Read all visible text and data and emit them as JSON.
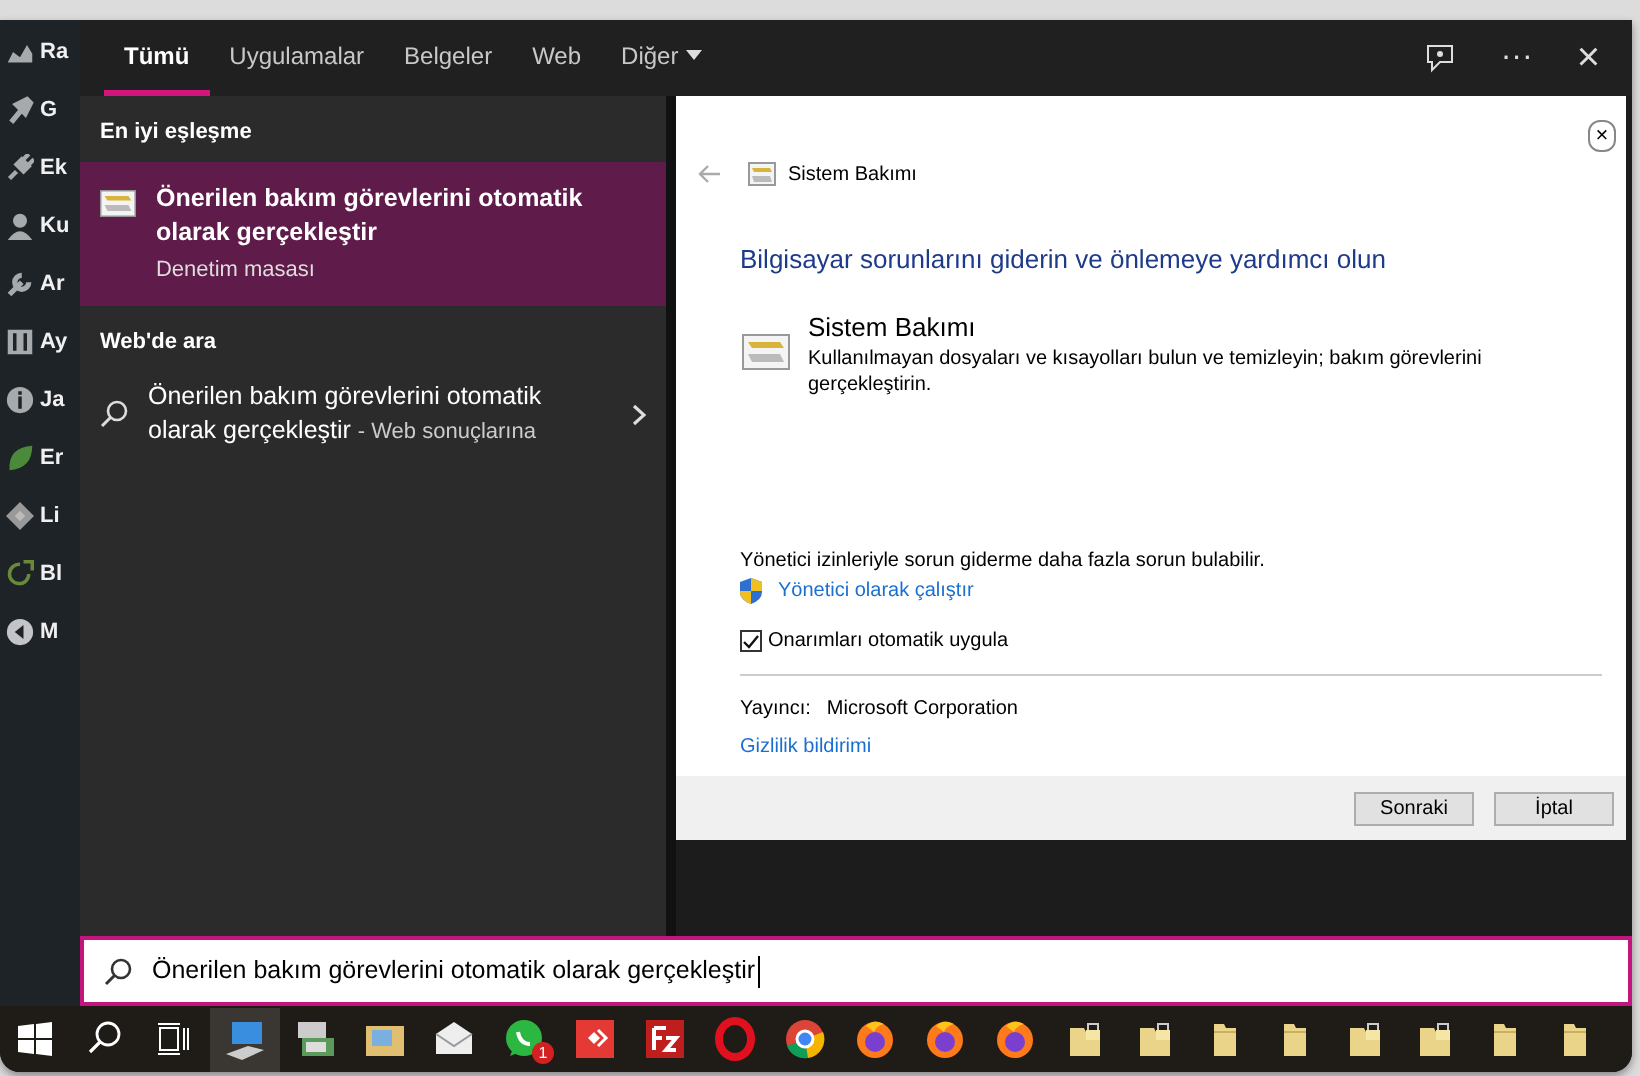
{
  "sidebar": {
    "items": [
      {
        "label": "Ra"
      },
      {
        "label": "G"
      },
      {
        "label": "Ek"
      },
      {
        "label": "Ku"
      },
      {
        "label": "Ar"
      },
      {
        "label": "Ay"
      },
      {
        "label": "Ja"
      },
      {
        "label": "Er"
      },
      {
        "label": "Li"
      },
      {
        "label": "Bl"
      },
      {
        "label": "M"
      }
    ]
  },
  "tabs": [
    {
      "label": "Tümü",
      "selected": true,
      "kind": "tab"
    },
    {
      "label": "Uygulamalar",
      "selected": false,
      "kind": "tab"
    },
    {
      "label": "Belgeler",
      "selected": false,
      "kind": "tab"
    },
    {
      "label": "Web",
      "selected": false,
      "kind": "tab"
    },
    {
      "label": "Diğer",
      "selected": false,
      "kind": "dropdown"
    }
  ],
  "toolbar": {
    "more": "···",
    "close": "×"
  },
  "best_match": {
    "heading": "En iyi eşleşme",
    "item": {
      "title": "Önerilen bakım görevlerini otomatik olarak gerçekleştir",
      "subtitle": "Denetim masası",
      "selected": true
    }
  },
  "web_search": {
    "heading": "Web'de ara",
    "item": {
      "title": "Önerilen bakım görevlerini otomatik olarak gerçekleştir",
      "suffix": "- Web sonuçlarına"
    }
  },
  "preview": {
    "breadcrumb": "Sistem Bakımı",
    "heading": "Bilgisayar sorunlarını giderin ve önlemeye yardımcı olun",
    "tool": {
      "title": "Sistem Bakımı",
      "description": "Kullanılmayan dosyaları ve kısayolları bulun ve temizleyin; bakım görevlerini gerçekleştirin."
    },
    "admin_note": "Yönetici izinleriyle sorun giderme daha fazla sorun bulabilir.",
    "admin_link": "Yönetici olarak çalıştır",
    "auto_repair": {
      "label": "Onarımları otomatik uygula",
      "checked": true
    },
    "publisher_label": "Yayıncı:",
    "publisher": "Microsoft Corporation",
    "privacy_link": "Gizlilik bildirimi",
    "buttons": [
      "Sonraki",
      "İptal"
    ]
  },
  "search_box": {
    "value": "Önerilen bakım görevlerini otomatik olarak gerçekleştir"
  },
  "taskbar": {
    "apps": [
      {
        "kind": "start",
        "active": false
      },
      {
        "kind": "search",
        "active": false
      },
      {
        "kind": "task-view",
        "active": false
      },
      {
        "kind": "computer",
        "active": true
      },
      {
        "kind": "scanner",
        "active": false
      },
      {
        "kind": "image-folder",
        "active": false
      },
      {
        "kind": "mail",
        "active": false
      },
      {
        "kind": "chat",
        "active": false,
        "badge": "1"
      },
      {
        "kind": "red-app",
        "active": false
      },
      {
        "kind": "ftp",
        "active": false
      },
      {
        "kind": "ring",
        "active": false
      },
      {
        "kind": "chrome",
        "active": false
      },
      {
        "kind": "fox",
        "active": false
      },
      {
        "kind": "fox",
        "active": false
      },
      {
        "kind": "fox",
        "active": false
      },
      {
        "kind": "lock-folder",
        "active": false
      },
      {
        "kind": "lock-folder",
        "active": false
      },
      {
        "kind": "folder",
        "active": false
      },
      {
        "kind": "folder",
        "active": false
      },
      {
        "kind": "lock-folder",
        "active": false
      },
      {
        "kind": "lock-folder",
        "active": false
      },
      {
        "kind": "folder",
        "active": false
      },
      {
        "kind": "folder",
        "active": false
      }
    ]
  }
}
